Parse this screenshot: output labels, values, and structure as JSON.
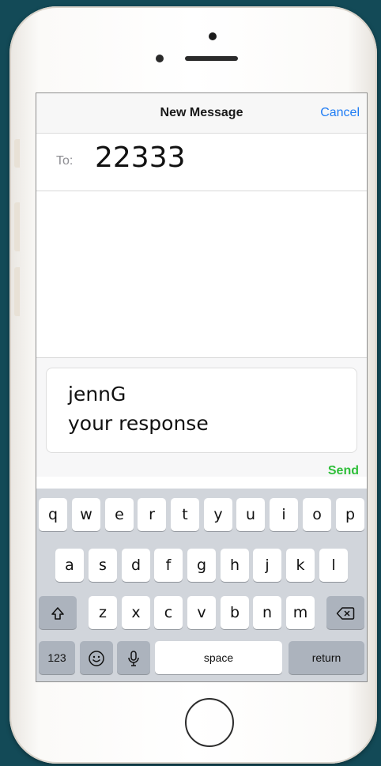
{
  "nav": {
    "title": "New Message",
    "cancel": "Cancel"
  },
  "to": {
    "label": "To:",
    "value": "22333"
  },
  "message": {
    "line1": "jennG",
    "line2": "your response"
  },
  "send": "Send",
  "keyboard": {
    "row1": [
      "q",
      "w",
      "e",
      "r",
      "t",
      "y",
      "u",
      "i",
      "o",
      "p"
    ],
    "row2": [
      "a",
      "s",
      "d",
      "f",
      "g",
      "h",
      "j",
      "k",
      "l"
    ],
    "row3": [
      "z",
      "x",
      "c",
      "v",
      "b",
      "n",
      "m"
    ],
    "numbers": "123",
    "space": "space",
    "return": "return"
  },
  "colors": {
    "accent_blue": "#1e7cf5",
    "send_green": "#2fbf3a",
    "background": "#134a57"
  },
  "icons": {
    "shift": "shift-icon",
    "backspace": "backspace-icon",
    "emoji": "emoji-icon",
    "mic": "microphone-icon"
  }
}
